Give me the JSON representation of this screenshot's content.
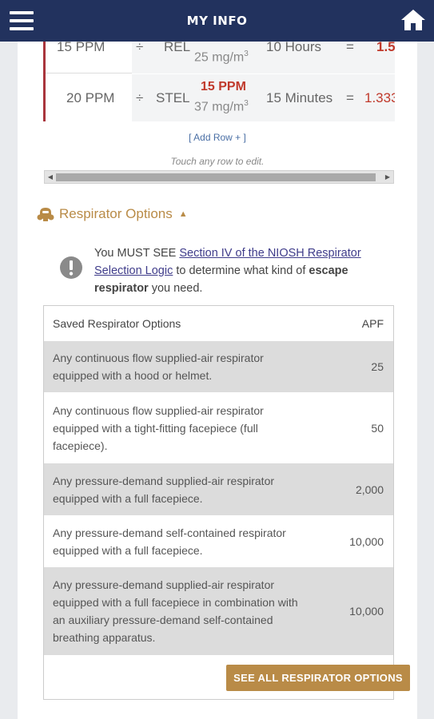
{
  "header": {
    "title": "MY INFO"
  },
  "calc": {
    "rows": [
      {
        "ppm": "15 PPM",
        "op": "÷",
        "type": "REL",
        "limit_ppm": "",
        "limit_mg": "25 mg/m",
        "time": "10 Hours",
        "eq": "=",
        "result": "1.5"
      },
      {
        "ppm": "20 PPM",
        "op": "÷",
        "type": "STEL",
        "limit_ppm": "15 PPM",
        "limit_mg": "37 mg/m",
        "time": "15 Minutes",
        "eq": "=",
        "result": "1.333"
      }
    ],
    "unit_exp": "3",
    "add_row": "[ Add Row + ]",
    "touch_hint": "Touch any row to edit."
  },
  "respirator": {
    "heading": "Respirator Options",
    "caret": "▲",
    "notice_pre": "You MUST SEE ",
    "notice_link": "Section IV of the NIOSH Respirator Selection Logic",
    "notice_mid": " to determine what kind of ",
    "notice_bold": "escape respirator",
    "notice_post": " you need.",
    "table_header": "Saved Respirator Options",
    "apf_header": "APF",
    "options": [
      {
        "desc": "Any continuous flow supplied-air respirator equipped with a hood or helmet.",
        "apf": "25"
      },
      {
        "desc": "Any continuous flow supplied-air respirator equipped with a tight-fitting facepiece (full facepiece).",
        "apf": "50"
      },
      {
        "desc": "Any pressure-demand supplied-air respirator equipped with a full facepiece.",
        "apf": "2,000"
      },
      {
        "desc": "Any pressure-demand self-contained respirator equipped with a full facepiece.",
        "apf": "10,000"
      },
      {
        "desc": "Any pressure-demand supplied-air respirator equipped with a full facepiece in combination with an auxiliary pressure-demand self-contained breathing apparatus.",
        "apf": "10,000"
      }
    ],
    "see_all": "SEE ALL RESPIRATOR OPTIONS"
  },
  "colors": {
    "header_bg": "#22325e",
    "accent_gold": "#b98b47",
    "result_red": "#c0392b",
    "row_shade": "#dcdcdc"
  }
}
